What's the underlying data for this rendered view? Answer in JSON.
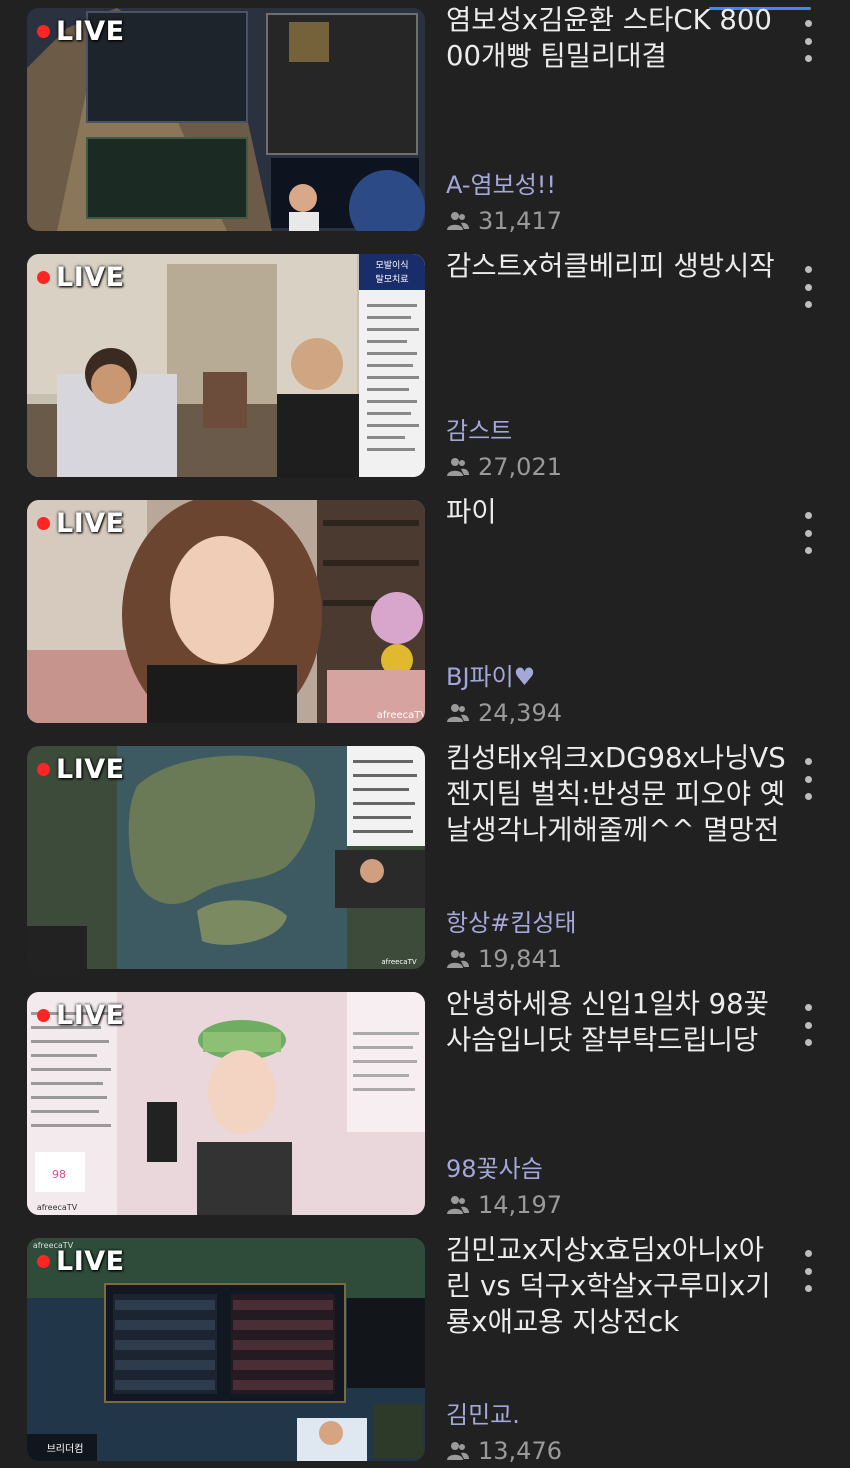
{
  "live_label": "LIVE",
  "colors": {
    "background": "#212121",
    "live_dot": "#ff2525",
    "channel_name": "#a3a7d9",
    "viewer_count": "#9a9a9a",
    "indicator": "#3f86f7"
  },
  "icons": {
    "viewers": "people-icon",
    "more": "more-vertical-icon"
  },
  "streams": [
    {
      "title": "염보성x김윤환 스타CK 80000개빵  팀밀리대결",
      "channel": "A-염보성!!",
      "viewers": "31,417"
    },
    {
      "title": "감스트x허클베리피 생방시작",
      "channel": "감스트",
      "viewers": "27,021",
      "thumb_overlay": "모발이식 탈모치료"
    },
    {
      "title": "파이",
      "channel": "BJ파이♥",
      "viewers": "24,394",
      "thumb_overlay": "afreecaTV"
    },
    {
      "title": "킴성태x워크xDG98x나닝VS젠지팀 벌칙:반성문 피오야 옛날생각나게해줄께^^ 멸망전",
      "channel": "항상#킴성태",
      "viewers": "19,841",
      "thumb_overlay": "afreecaTV"
    },
    {
      "title": "안녕하세용 신입1일차 98꽃사슴입니닷 잘부탁드립니당",
      "channel": "98꽃사슴",
      "viewers": "14,197",
      "thumb_overlay": "afreecaTV"
    },
    {
      "title": "김민교x지상x효딤x아니x아린 vs 덕구x학살x구루미x기룡x애교용 지상전ck",
      "channel": "김민교.",
      "viewers": "13,476",
      "thumb_overlay": "afreecaTV"
    }
  ]
}
